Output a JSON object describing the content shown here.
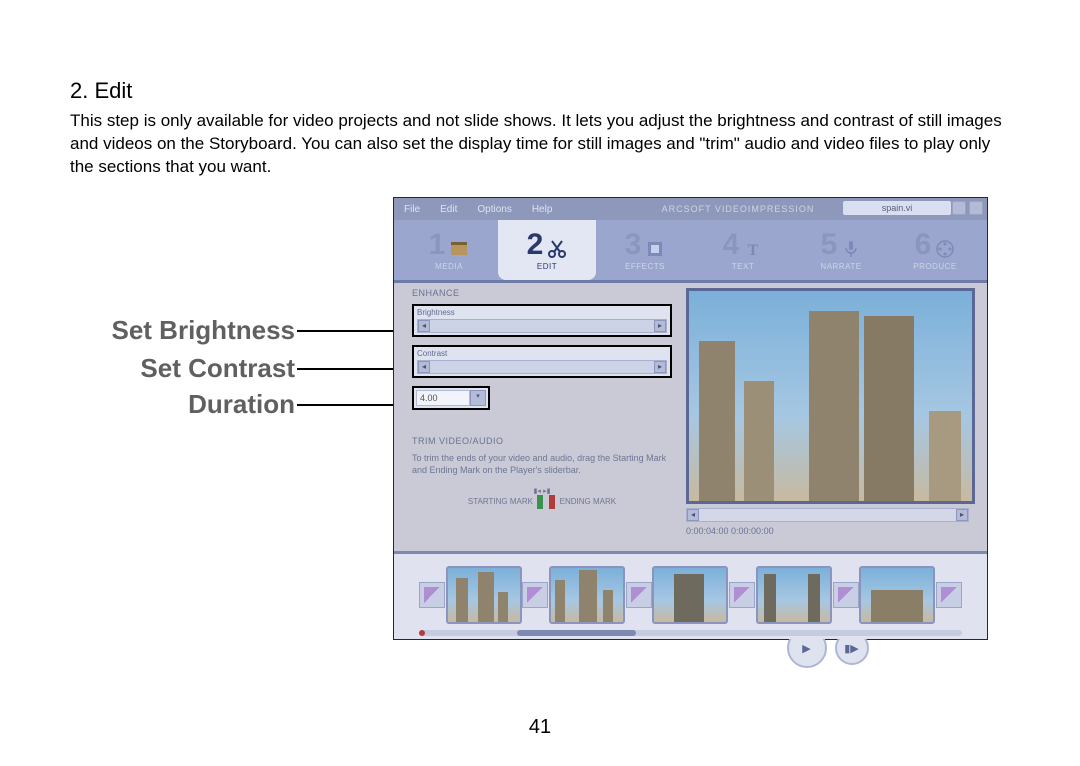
{
  "section_title": "2. Edit",
  "body_text": "This step is only available for video projects and not slide shows. It lets you adjust the brightness and contrast of still images and videos on the Storyboard. You can also set the display time for still images and \"trim\" audio and video files to play only the sections that you want.",
  "page_number": "41",
  "callouts": {
    "brightness": "Set Brightness",
    "contrast": "Set Contrast",
    "duration": "Duration"
  },
  "app": {
    "menu": {
      "file": "File",
      "edit": "Edit",
      "options": "Options",
      "help": "Help"
    },
    "brand": "ARCSOFT  VIDEOIMPRESSION",
    "document": "spain.vi",
    "tabs": [
      {
        "n": "1",
        "label": "MEDIA"
      },
      {
        "n": "2",
        "label": "EDIT"
      },
      {
        "n": "3",
        "label": "EFFECTS"
      },
      {
        "n": "4",
        "label": "TEXT"
      },
      {
        "n": "5",
        "label": "NARRATE"
      },
      {
        "n": "6",
        "label": "PRODUCE"
      }
    ],
    "enhance": {
      "section": "ENHANCE",
      "brightness_label": "Brightness",
      "contrast_label": "Contrast",
      "duration_value": "4.00"
    },
    "trim": {
      "section": "TRIM VIDEO/AUDIO",
      "tip": "To trim the ends of your video and audio, drag the Starting Mark and Ending Mark on the Player's sliderbar.",
      "start": "STARTING MARK",
      "end": "ENDING MARK"
    },
    "preview": {
      "timecode": "0:00:04:00  0:00:00:00"
    }
  }
}
